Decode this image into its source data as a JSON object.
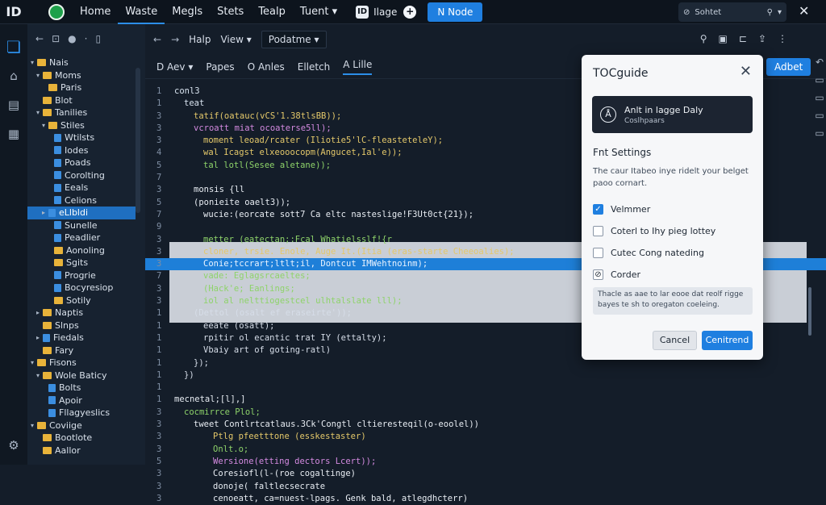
{
  "topbar": {
    "logo": "ID",
    "menu": [
      "Home",
      "Waste",
      "Megls",
      "Stets",
      "Tealp",
      "Tuent ▾"
    ],
    "active_index": 1,
    "sep_label": "ID",
    "page_label": "Ilage",
    "new_button": "N Node",
    "search_value": "Sohtet",
    "search_icon": "search-icon",
    "close": "✕"
  },
  "editor_toolbar": {
    "items": [
      "Halp",
      "View ▾"
    ],
    "dropdown": "Podatme ▾"
  },
  "editor_tabs": [
    "D Aev ▾",
    "Papes",
    "O Anles",
    "Elletch",
    "A Lille"
  ],
  "apply_button": "Adbet",
  "explorer_tree": [
    {
      "label": "Nais",
      "kind": "folder",
      "indent": 0,
      "chev": "▾"
    },
    {
      "label": "Moms",
      "kind": "folder",
      "indent": 1,
      "chev": "▾"
    },
    {
      "label": "Paris",
      "kind": "folder",
      "indent": 2,
      "chev": ""
    },
    {
      "label": "Blot",
      "kind": "folder",
      "indent": 1,
      "chev": ""
    },
    {
      "label": "Tanilies",
      "kind": "folder",
      "indent": 1,
      "chev": "▾"
    },
    {
      "label": "Stiles",
      "kind": "folder",
      "indent": 2,
      "chev": "▾"
    },
    {
      "label": "Wtilsts",
      "kind": "file",
      "indent": 3,
      "chev": ""
    },
    {
      "label": "Iodes",
      "kind": "file",
      "indent": 3,
      "chev": ""
    },
    {
      "label": "Poads",
      "kind": "file",
      "indent": 3,
      "chev": ""
    },
    {
      "label": "Corolting",
      "kind": "file",
      "indent": 3,
      "chev": ""
    },
    {
      "label": "Eeals",
      "kind": "file",
      "indent": 3,
      "chev": ""
    },
    {
      "label": "Celions",
      "kind": "file",
      "indent": 3,
      "chev": ""
    },
    {
      "label": "eLlbldi",
      "kind": "file",
      "indent": 2,
      "chev": "▸",
      "selected": true
    },
    {
      "label": "Sunelle",
      "kind": "file",
      "indent": 3,
      "chev": ""
    },
    {
      "label": "Peadlier",
      "kind": "file",
      "indent": 3,
      "chev": ""
    },
    {
      "label": "Aonoling",
      "kind": "folder",
      "indent": 3,
      "chev": ""
    },
    {
      "label": "Sgits",
      "kind": "folder",
      "indent": 3,
      "chev": ""
    },
    {
      "label": "Progrie",
      "kind": "file",
      "indent": 3,
      "chev": ""
    },
    {
      "label": "Bocyresiop",
      "kind": "file",
      "indent": 3,
      "chev": ""
    },
    {
      "label": "Sotily",
      "kind": "folder",
      "indent": 3,
      "chev": ""
    },
    {
      "label": "Naptis",
      "kind": "folder",
      "indent": 1,
      "chev": "▸"
    },
    {
      "label": "Slnps",
      "kind": "folder",
      "indent": 1,
      "chev": ""
    },
    {
      "label": "Fiedals",
      "kind": "file",
      "indent": 1,
      "chev": "▸"
    },
    {
      "label": "Fary",
      "kind": "folder",
      "indent": 1,
      "chev": ""
    },
    {
      "label": "Fisons",
      "kind": "folder",
      "indent": 0,
      "chev": "▾"
    },
    {
      "label": "Wole Baticy",
      "kind": "folder",
      "indent": 1,
      "chev": "▾"
    },
    {
      "label": "Bolts",
      "kind": "file",
      "indent": 2,
      "chev": ""
    },
    {
      "label": "Apoir",
      "kind": "file",
      "indent": 2,
      "chev": ""
    },
    {
      "label": "Fllagyeslics",
      "kind": "file",
      "indent": 2,
      "chev": ""
    },
    {
      "label": "Coviige",
      "kind": "folder",
      "indent": 0,
      "chev": "▾"
    },
    {
      "label": "Bootlote",
      "kind": "folder",
      "indent": 1,
      "chev": ""
    },
    {
      "label": "Aallor",
      "kind": "folder",
      "indent": 1,
      "chev": ""
    }
  ],
  "code_lines": [
    {
      "n": "1",
      "t": "conl3",
      "c": "c-k",
      "indent": 0
    },
    {
      "n": "1",
      "t": "teat",
      "c": "c-k",
      "indent": 1
    },
    {
      "n": "3",
      "t": "tatif(oatauc(vCS'1.38tlsBB));",
      "c": "c-y",
      "indent": 2
    },
    {
      "n": "3",
      "t": "vcroatt miat ocoaterse5ll);",
      "c": "c-p",
      "indent": 2
    },
    {
      "n": "3",
      "t": "moment leoad/rcater (Iliotie5'lC-fleasteteleY);",
      "c": "c-y",
      "indent": 3
    },
    {
      "n": "4",
      "t": "wal Icagst elxeooocopm(Angucet,Ial'e));",
      "c": "c-y",
      "indent": 3
    },
    {
      "n": "5",
      "t": "tal lotl(Sesee aletane));",
      "c": "c-g",
      "indent": 3
    },
    {
      "n": "7",
      "t": "",
      "c": "c-k",
      "indent": 0
    },
    {
      "n": "3",
      "t": "monsis {ll",
      "c": "c-w",
      "indent": 2
    },
    {
      "n": "5",
      "t": "(ponieite oaelt3));",
      "c": "c-w",
      "indent": 2
    },
    {
      "n": "7",
      "t": "wucie:(eorcate sott7 Ca eltc nasteslige!F3Ut0ct{21});",
      "c": "c-w",
      "indent": 3
    },
    {
      "n": "9",
      "t": "",
      "c": "c-k",
      "indent": 0
    },
    {
      "n": "3",
      "t": "metter (eatectan;:Fcal Whatielsslf!{r",
      "c": "c-g",
      "indent": 3
    },
    {
      "n": "3",
      "t": "cloner, trsie. Enole, Auge It.(Itia (eras-starte Cheeoalies);",
      "c": "c-y",
      "indent": 3
    },
    {
      "n": "3",
      "t": "Conie;tccrart;ltlt;il, Dontcut IMWehtnoinm);",
      "c": "c-g",
      "indent": 3,
      "hl": true
    },
    {
      "n": "7",
      "t": "vade: Eglagsrcaeltes;",
      "c": "c-g",
      "indent": 3
    },
    {
      "n": "3",
      "t": "(Hack'e; Eanlings;",
      "c": "c-g",
      "indent": 3
    },
    {
      "n": "3",
      "t": "iol al nelttiogestcel ulhtalslate lll);",
      "c": "c-g",
      "indent": 3
    },
    {
      "n": "1",
      "t": "(Dettol (osalt ef eraseirte'));",
      "c": "c-r2",
      "indent": 2,
      "light": true
    },
    {
      "n": "1",
      "t": "eeate (osatt);",
      "c": "c-d",
      "indent": 3,
      "light": true
    },
    {
      "n": "1",
      "t": "rpitir ol ecantic trat IY (ettalty);",
      "c": "c-r2",
      "indent": 3,
      "light": true
    },
    {
      "n": "1",
      "t": "Vbaiy art of goting-ratl)",
      "c": "c-r2",
      "indent": 3,
      "light": true
    },
    {
      "n": "1",
      "t": "});",
      "c": "c-d",
      "indent": 2,
      "light": true
    },
    {
      "n": "1",
      "t": "})",
      "c": "c-d",
      "indent": 1,
      "light": true
    },
    {
      "n": "1",
      "t": "",
      "c": "c-k",
      "indent": 0
    },
    {
      "n": "1",
      "t": "mecnetal;[l],]",
      "c": "c-w",
      "indent": 0
    },
    {
      "n": "3",
      "t": "cocmirrce Plol;",
      "c": "c-g",
      "indent": 1
    },
    {
      "n": "3",
      "t": "tweet Contlrtcatlaus.3Ck'Congtl cltieresteqil(o-eoolel))",
      "c": "c-w",
      "indent": 2
    },
    {
      "n": "3",
      "t": "Ptlg pfeetttone (esskestaster)",
      "c": "c-y",
      "indent": 4
    },
    {
      "n": "3",
      "t": "Onlt.o;",
      "c": "c-g",
      "indent": 4
    },
    {
      "n": "5",
      "t": "Wersione(etting dectors Lcert));",
      "c": "c-p",
      "indent": 4
    },
    {
      "n": "3",
      "t": "Coresiofl(l-(roe cogaltinge)",
      "c": "c-w",
      "indent": 4
    },
    {
      "n": "3",
      "t": "donoje( faltlecsecrate",
      "c": "c-w",
      "indent": 4
    },
    {
      "n": "3",
      "t": "cenoeatt, ca=nuest-lpags. Genk bald, atlegdhcterr)",
      "c": "c-w",
      "indent": 4
    }
  ],
  "dialog": {
    "title": "TOCguide",
    "card_title": "Anlt in lagge Daly",
    "card_sub": "Coslhpaars",
    "section": "Fnt Settings",
    "desc": "The caur Itabeo inye ridelt your belget paoo cornart.",
    "options": [
      {
        "label": "Velmmer",
        "state": "on"
      },
      {
        "label": "Coterl to Ihy pieg lottey",
        "state": "off"
      },
      {
        "label": "Cutec Cong nateding",
        "state": "off"
      },
      {
        "label": "Corder",
        "state": "dash"
      }
    ],
    "note": "Thacle as aae to lar eooe dat reolf rigge bayes te sh to oregaton coeleing.",
    "cancel": "Cancel",
    "confirm": "Cenitrend"
  }
}
